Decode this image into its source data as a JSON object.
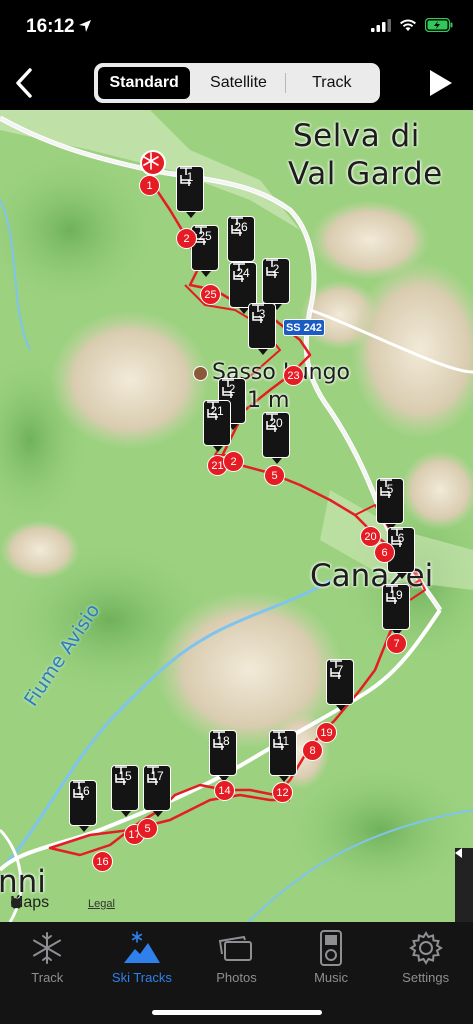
{
  "status": {
    "time": "16:12"
  },
  "nav": {
    "segments": [
      "Standard",
      "Satellite",
      "Track"
    ],
    "selected_segment": "Standard"
  },
  "map": {
    "labels": {
      "selva_line1": "Selva di",
      "selva_line2": "Val Garde",
      "sasso_line1": "Sasso Lungo",
      "sasso_line2": "81 m",
      "canazei": "Canazei",
      "avisio": "Fiume Avisio",
      "nni": "nni",
      "road": "SS 242"
    },
    "brand": "Maps",
    "legal": "Legal",
    "lifts": [
      "1",
      "2",
      "3",
      "24",
      "25",
      "26",
      "21",
      "20",
      "5",
      "6",
      "19",
      "7",
      "11",
      "18",
      "15",
      "16",
      "17",
      "2"
    ],
    "runs": [
      "1",
      "2",
      "25",
      "23",
      "21",
      "2",
      "5",
      "20",
      "6",
      "7",
      "19",
      "8",
      "12",
      "14",
      "17",
      "5",
      "16"
    ]
  },
  "tabs": [
    {
      "label": "Track",
      "icon": "snowflake-icon"
    },
    {
      "label": "Ski Tracks",
      "icon": "mountain-icon"
    },
    {
      "label": "Photos",
      "icon": "photos-icon"
    },
    {
      "label": "Music",
      "icon": "music-player-icon"
    },
    {
      "label": "Settings",
      "icon": "gear-icon"
    }
  ],
  "active_tab": "Ski Tracks",
  "colors": {
    "accent": "#2f80ed",
    "track": "#e51c23",
    "map_green": "#9bd17f"
  }
}
